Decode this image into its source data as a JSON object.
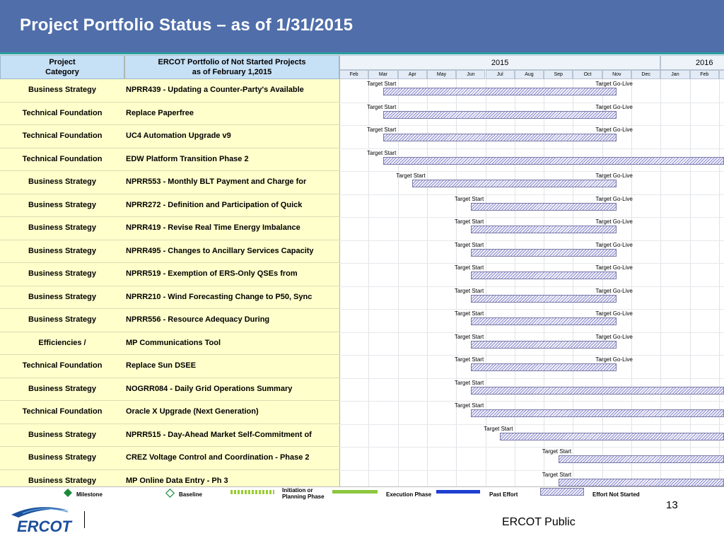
{
  "title": "Project Portfolio Status – as of 1/31/2015",
  "header": {
    "category": "Project\nCategory",
    "portfolio": "ERCOT Portfolio of Not Started Projects\nas of February 1,2015"
  },
  "years": [
    "2015",
    "2016"
  ],
  "months": [
    "Feb",
    "Mar",
    "Apr",
    "May",
    "Jun",
    "Jul",
    "Aug",
    "Sep",
    "Oct",
    "Nov",
    "Dec",
    "Jan",
    "Feb",
    "Mar"
  ],
  "labels": {
    "start": "Target Start",
    "golive": "Target Go-Live"
  },
  "rows": [
    {
      "category": "Business Strategy",
      "project": "NPRR439 - Updating a Counter-Party's Available",
      "start": "Mar",
      "golive": "Nov",
      "open": false
    },
    {
      "category": "Technical Foundation",
      "project": "Replace Paperfree",
      "start": "Mar",
      "golive": "Nov",
      "open": false
    },
    {
      "category": "Technical Foundation",
      "project": "UC4 Automation Upgrade v9",
      "start": "Mar",
      "golive": "Nov",
      "open": false
    },
    {
      "category": "Technical Foundation",
      "project": "EDW Platform Transition Phase 2",
      "start": "Mar",
      "golive": "",
      "open": true
    },
    {
      "category": "Business Strategy",
      "project": "NPRR553 - Monthly BLT Payment and Charge for",
      "start": "Apr",
      "golive": "Nov",
      "open": false
    },
    {
      "category": "Business Strategy",
      "project": "NPRR272 - Definition and Participation of Quick",
      "start": "Jun",
      "golive": "Nov",
      "open": false
    },
    {
      "category": "Business Strategy",
      "project": "NPRR419 - Revise Real Time Energy Imbalance",
      "start": "Jun",
      "golive": "Nov",
      "open": false
    },
    {
      "category": "Business Strategy",
      "project": "NPRR495 - Changes to Ancillary Services Capacity",
      "start": "Jun",
      "golive": "Nov",
      "open": false
    },
    {
      "category": "Business Strategy",
      "project": "NPRR519 - Exemption of ERS-Only QSEs from",
      "start": "Jun",
      "golive": "Nov",
      "open": false
    },
    {
      "category": "Business Strategy",
      "project": "NPRR210 - Wind Forecasting Change to P50, Sync",
      "start": "Jun",
      "golive": "Nov",
      "open": false
    },
    {
      "category": "Business Strategy",
      "project": "NPRR556 - Resource Adequacy During",
      "start": "Jun",
      "golive": "Nov",
      "open": false
    },
    {
      "category": "Efficiencies /",
      "project": "MP Communications Tool",
      "start": "Jun",
      "golive": "Nov",
      "open": false
    },
    {
      "category": "Technical Foundation",
      "project": "Replace Sun DSEE",
      "start": "Jun",
      "golive": "Nov",
      "open": false
    },
    {
      "category": "Business Strategy",
      "project": "NOGRR084 - Daily Grid Operations Summary",
      "start": "Jun",
      "golive": "",
      "open": true
    },
    {
      "category": "Technical Foundation",
      "project": "Oracle X Upgrade (Next Generation)",
      "start": "Jun",
      "golive": "",
      "open": true
    },
    {
      "category": "Business Strategy",
      "project": "NPRR515 - Day-Ahead Market Self-Commitment of",
      "start": "Jul",
      "golive": "",
      "open": true
    },
    {
      "category": "Business Strategy",
      "project": "CREZ Voltage Control and Coordination - Phase 2",
      "start": "Sep",
      "golive": "",
      "open": true
    },
    {
      "category": "Business Strategy",
      "project": "MP Online Data Entry - Ph 3",
      "start": "Sep",
      "golive": "",
      "open": true
    }
  ],
  "legend": {
    "milestone": "Milestone",
    "baseline": "Baseline",
    "initiation": "Initiation or\nPlanning Phase",
    "execution": "Execution Phase",
    "past": "Past Effort",
    "notstarted": "Effort Not Started"
  },
  "colors": {
    "title_bg": "#4f6eaa",
    "row_bg": "#ffffcc",
    "milestone": "#1a8a3a",
    "initiation": "#9acd32",
    "execution": "#8dc63f",
    "past": "#1f3fd0",
    "not_started_hatch": "#8b8bcf"
  },
  "footer": {
    "page": "13",
    "public": "ERCOT Public",
    "logo": "ERCOT"
  }
}
